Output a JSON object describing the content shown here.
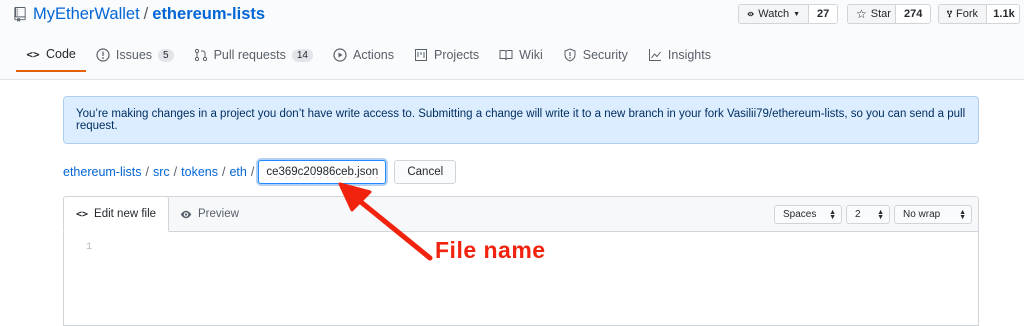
{
  "repo": {
    "owner": "MyEtherWallet",
    "separator": "/",
    "name": "ethereum-lists"
  },
  "actions": {
    "watch": {
      "label": "Watch",
      "count": "27"
    },
    "star": {
      "label": "Star",
      "count": "274"
    },
    "fork": {
      "label": "Fork",
      "count": "1.1k"
    }
  },
  "tabs": [
    {
      "label": "Code",
      "icon": "code-icon"
    },
    {
      "label": "Issues",
      "count": "5",
      "icon": "issue-icon"
    },
    {
      "label": "Pull requests",
      "count": "14",
      "icon": "pull-request-icon"
    },
    {
      "label": "Actions",
      "icon": "play-icon"
    },
    {
      "label": "Projects",
      "icon": "project-icon"
    },
    {
      "label": "Wiki",
      "icon": "book-icon"
    },
    {
      "label": "Security",
      "icon": "shield-icon"
    },
    {
      "label": "Insights",
      "icon": "graph-icon"
    }
  ],
  "flash": {
    "message": "You’re making changes in a project you don’t have write access to. Submitting a change will write it to a new branch in your fork Vasilii79/ethereum-lists, so you can send a pull request."
  },
  "breadcrumb": {
    "items": [
      "ethereum-lists",
      "src",
      "tokens",
      "eth"
    ],
    "separator": "/"
  },
  "filename": {
    "value": "ce369c20986ceb.json"
  },
  "cancel_label": "Cancel",
  "editor": {
    "edit_tab": "Edit new file",
    "preview_tab": "Preview",
    "indent_mode": "Spaces",
    "indent_size": "2",
    "wrap_mode": "No wrap",
    "line_number": "1"
  },
  "annotation": {
    "text": "File name",
    "color": "#f1230e"
  },
  "colors": {
    "link": "#0366d6",
    "active_tab_border": "#e36209",
    "flash_bg": "#dbedff"
  }
}
